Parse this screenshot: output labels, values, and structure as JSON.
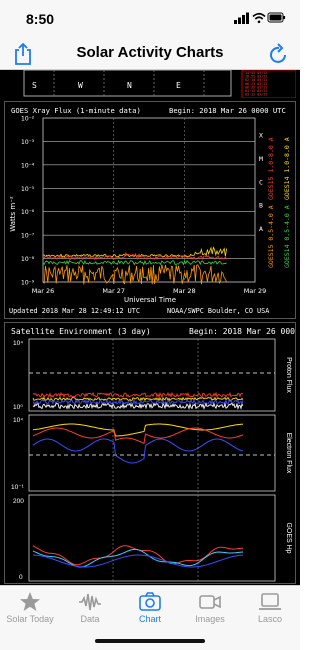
{
  "status": {
    "time": "8:50"
  },
  "nav": {
    "title": "Solar Activity Charts"
  },
  "top_strip": {
    "compass": [
      "S",
      "W",
      "N",
      "E"
    ],
    "times": [
      "14:45 03/22",
      "18:55 03/22",
      "02:10 03/22",
      "06:25 03/22",
      "06:35 03/22",
      "04:15 03/22",
      "03:12 03/22"
    ]
  },
  "xray": {
    "title": "GOES Xray Flux (1-minute data)",
    "begin": "Begin:  2018 Mar 26 0000 UTC",
    "ylabel": "Watts m⁻²",
    "yticks": [
      "10⁻²",
      "10⁻³",
      "10⁻⁴",
      "10⁻⁵",
      "10⁻⁶",
      "10⁻⁷",
      "10⁻⁸",
      "10⁻⁹"
    ],
    "classes": [
      "X",
      "M",
      "C",
      "B",
      "A"
    ],
    "xticks": [
      "Mar 26",
      "Mar 27",
      "Mar 28",
      "Mar 29"
    ],
    "xlabel": "Universal Time",
    "legend_right": [
      "GOES15 1.0-8.0 A",
      "GOES14 1.0-8.0 A"
    ],
    "legend_left": [
      "GOES15 0.5-4.0 A",
      "GOES14 0.5-4.0 A"
    ],
    "updated": "Updated 2018 Mar 28 12:49:12 UTC",
    "source": "NOAA/SWPC Boulder, CO USA",
    "colors": {
      "long_15": "#ff3b30",
      "long_14": "#ffdd00",
      "short_15": "#ff9a00",
      "short_14": "#38d64a"
    }
  },
  "sat_env": {
    "title": "Satellite Environment (3 day)",
    "begin": "Begin: 2018 Mar 26 0000 UTC",
    "labels": [
      "Proton Flux",
      "Electron Flux",
      "GOES Hp"
    ],
    "proton_yticks": [
      "10⁴",
      "10⁰"
    ],
    "electron_yticks": [
      "10⁴",
      "10⁻¹"
    ],
    "hp_yticks": [
      "200",
      "0"
    ]
  },
  "tabs": [
    {
      "label": "Solar Today",
      "icon": "star-icon",
      "active": false
    },
    {
      "label": "Data",
      "icon": "waveform-icon",
      "active": false
    },
    {
      "label": "Chart",
      "icon": "camera-icon",
      "active": true
    },
    {
      "label": "Images",
      "icon": "video-camera-icon",
      "active": false
    },
    {
      "label": "Lasco",
      "icon": "laptop-icon",
      "active": false
    }
  ]
}
